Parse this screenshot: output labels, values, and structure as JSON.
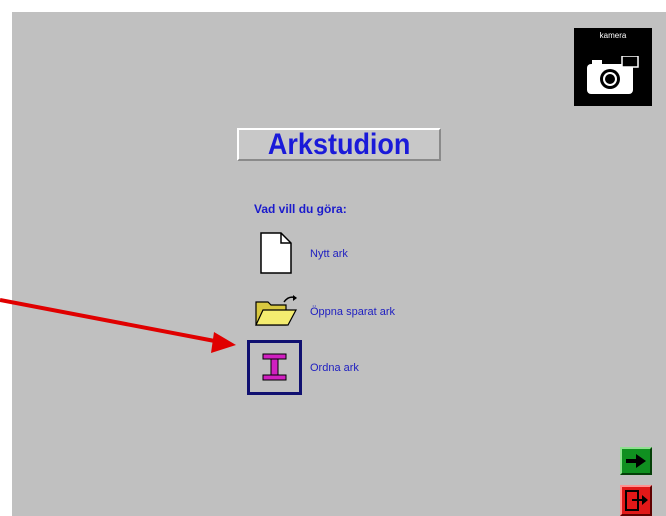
{
  "app": {
    "title": "Arkstudion"
  },
  "camera": {
    "label": "kamera",
    "icon": "camera-icon"
  },
  "prompt": {
    "question": "Vad vill du göra:"
  },
  "menu": {
    "new_sheet": {
      "label": "Nytt ark",
      "icon": "blank-document-icon"
    },
    "open_sheet": {
      "label": "Öppna sparat ark",
      "icon": "open-folder-icon"
    },
    "order_sheets": {
      "label": "Ordna ark",
      "icon": "i-beam-icon",
      "selected": true
    }
  },
  "navigation": {
    "next_icon": "right-arrow-icon",
    "exit_icon": "exit-door-icon"
  },
  "colors": {
    "background": "#c0c0c0",
    "title": "#1a1ad9",
    "link": "#2020c0",
    "annotation_arrow": "#e00000",
    "next_button": "#109020",
    "exit_button": "#e01818"
  }
}
